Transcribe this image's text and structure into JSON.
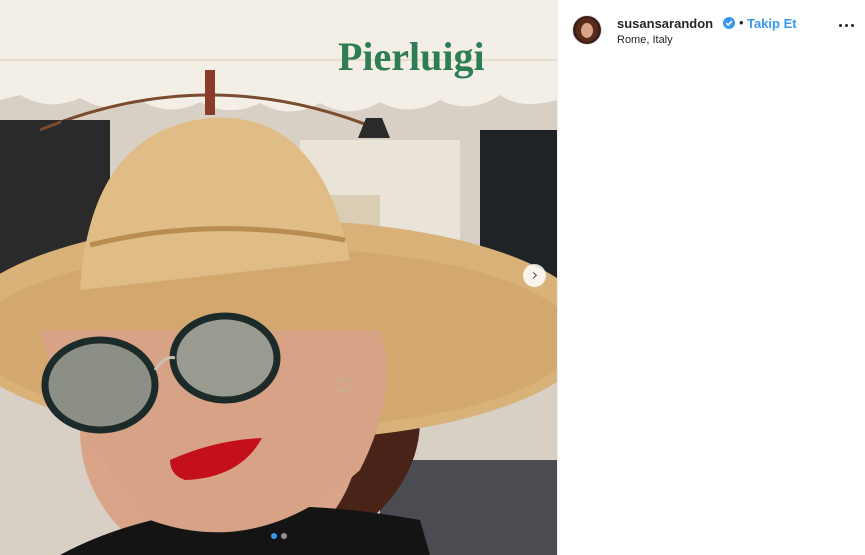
{
  "post": {
    "username": "susansarandon",
    "verified": true,
    "separator": "•",
    "follow_label": "Takip Et",
    "location": "Rome, Italy",
    "accent_color": "#3897f0",
    "photo_sign_text": "Pierluigi",
    "carousel": {
      "total": 2,
      "current": 1
    },
    "icons": [
      "verified-badge-icon",
      "more-options-icon",
      "chevron-right-icon"
    ]
  }
}
